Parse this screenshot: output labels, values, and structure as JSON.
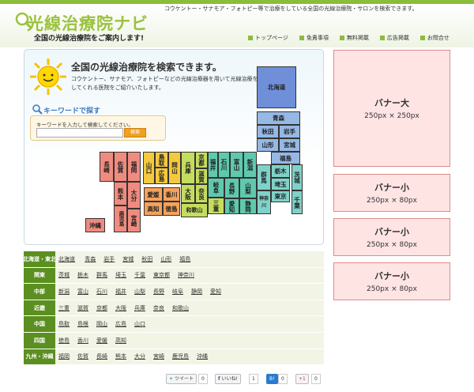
{
  "header": {
    "logo": "光線治療院ナビ",
    "tagline": "全国の光線治療院をご案内します!",
    "description": "コウケントー・サナモア・フォトピー等で治療をしている全国の光線治療院・サロンを検索できます。",
    "nav": [
      "トップページ",
      "免責事項",
      "無料掲載",
      "広告掲載",
      "お問合せ"
    ]
  },
  "map": {
    "title": "全国の光線治療院を検索できます。",
    "desc": "コウケントー、サナモア、フォトピーなどの光線治療器を用いて光線治療をしてくれる医院をご紹介いたします。",
    "keyword_title": "キーワードで探す",
    "keyword_hint": "キーワードを入力して検索してください。",
    "search_button": "検索"
  },
  "prefs": {
    "hokkaido": "北海道",
    "aomori": "青森",
    "akita": "秋田",
    "iwate": "岩手",
    "yamagata": "山形",
    "miyagi": "宮城",
    "fukushima": "福島",
    "niigata": "新潟",
    "toyama": "富山",
    "ishikawa": "石川",
    "fukui": "福井",
    "gunma": "群馬",
    "tochigi": "栃木",
    "ibaraki": "茨城",
    "saitama": "埼玉",
    "tokyo": "東京",
    "kanagawa": "神奈川",
    "chiba": "千葉",
    "nagano": "長野",
    "yamanashi": "山梨",
    "gifu": "岐阜",
    "aichi": "愛知",
    "shizuoka": "静岡",
    "kyoto": "京都",
    "shiga": "滋賀",
    "hyogo": "兵庫",
    "osaka": "大阪",
    "nara": "奈良",
    "mie": "三重",
    "wakayama": "和歌山",
    "tottori": "鳥取",
    "shimane": "島根",
    "okayama": "岡山",
    "hiroshima": "広島",
    "yamaguchi": "山口",
    "kagawa": "香川",
    "ehime": "愛媛",
    "kochi": "高知",
    "tokushima": "徳島",
    "fukuoka": "福岡",
    "saga": "佐賀",
    "nagasaki": "長崎",
    "oita": "大分",
    "kumamoto": "熊本",
    "miyazaki": "宮崎",
    "kagoshima": "鹿児島",
    "okinawa": "沖縄"
  },
  "regions": [
    {
      "name": "北海道・東北",
      "prefs": [
        "北海道",
        "青森",
        "岩手",
        "宮城",
        "秋田",
        "山形",
        "福島"
      ]
    },
    {
      "name": "関東",
      "prefs": [
        "茨城",
        "栃木",
        "群馬",
        "埼玉",
        "千葉",
        "東京都",
        "神奈川"
      ]
    },
    {
      "name": "中部",
      "prefs": [
        "新潟",
        "富山",
        "石川",
        "福井",
        "山梨",
        "長野",
        "岐阜",
        "静岡",
        "愛知"
      ]
    },
    {
      "name": "近畿",
      "prefs": [
        "三重",
        "滋賀",
        "京都",
        "大阪",
        "兵庫",
        "奈良",
        "和歌山"
      ]
    },
    {
      "name": "中国",
      "prefs": [
        "鳥取",
        "島根",
        "岡山",
        "広島",
        "山口"
      ]
    },
    {
      "name": "四国",
      "prefs": [
        "徳島",
        "香川",
        "愛媛",
        "高知"
      ]
    },
    {
      "name": "九州・沖縄",
      "prefs": [
        "福岡",
        "佐賀",
        "長崎",
        "熊本",
        "大分",
        "宮崎",
        "鹿児島",
        "沖縄"
      ]
    }
  ],
  "social": {
    "tweet": "ツイート",
    "tweet_count": "0",
    "like": "いいね!",
    "like_count": "1",
    "hatena": "B!",
    "hatena_count": "0",
    "gplus": "+1",
    "gplus_count": "0"
  },
  "banners": [
    {
      "title": "バナー大",
      "size": "250px × 250px"
    },
    {
      "title": "バナー小",
      "size": "250px × 80px"
    },
    {
      "title": "バナー小",
      "size": "250px × 80px"
    },
    {
      "title": "バナー小",
      "size": "250px × 80px"
    }
  ],
  "colors": {
    "brand_green": "#8bbd3c",
    "region_bg": "#5b8f20",
    "banner_bg": "#ffe4e4"
  }
}
